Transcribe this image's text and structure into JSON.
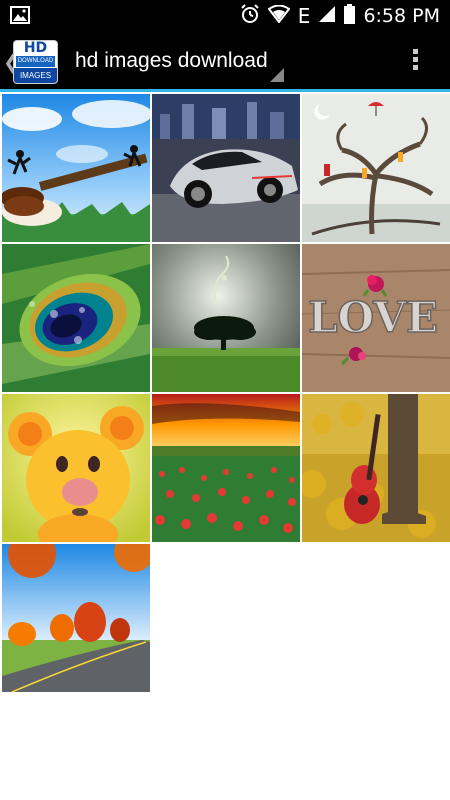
{
  "status_bar": {
    "time": "6:58 PM",
    "network_letter": "E",
    "icons": [
      "image-notification-icon",
      "alarm-icon",
      "wifi-icon",
      "signal-icon",
      "battery-icon"
    ]
  },
  "action_bar": {
    "title": "hd images download",
    "app_icon_text": {
      "top": "HD",
      "middle": "DOWNLOAD",
      "bottom": "IMAGES"
    },
    "accent_color": "#33b5e5"
  },
  "thumbnails": [
    {
      "id": "guitar-sky"
    },
    {
      "id": "sports-car-city"
    },
    {
      "id": "fantasy-tree"
    },
    {
      "id": "peacock-feather"
    },
    {
      "id": "tree-field"
    },
    {
      "id": "love-wood"
    },
    {
      "id": "yellow-bear"
    },
    {
      "id": "poppy-field"
    },
    {
      "id": "guitar-autumn"
    },
    {
      "id": "autumn-road"
    }
  ]
}
